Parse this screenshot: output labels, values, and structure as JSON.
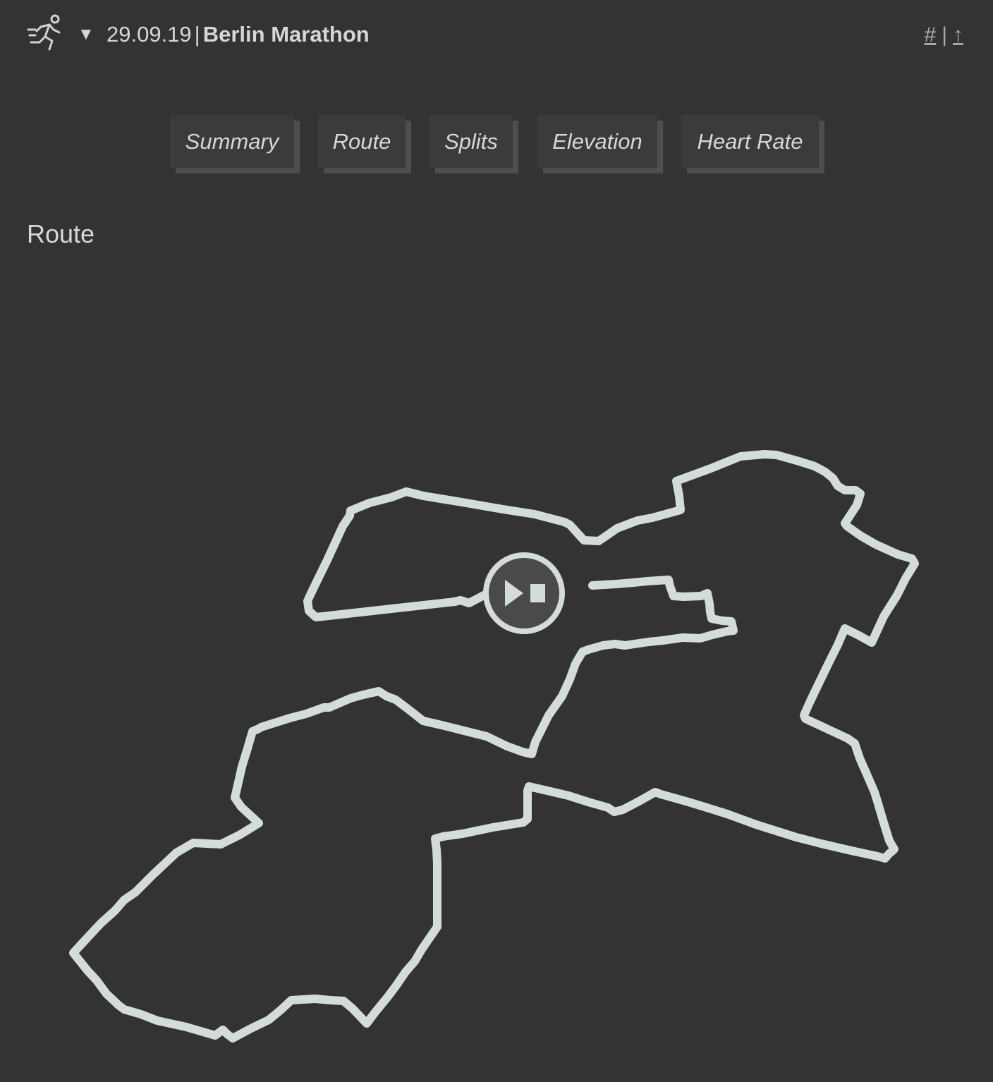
{
  "header": {
    "icon": "runner-icon",
    "toggle_icon": "triangle-down-icon",
    "toggle_glyph": "▼",
    "date": "29.09.19",
    "separator": "|",
    "event": "Berlin Marathon",
    "links": {
      "hash": "#",
      "divider": "|",
      "up": "↑"
    }
  },
  "tabs": [
    {
      "label": "Summary"
    },
    {
      "label": "Route"
    },
    {
      "label": "Splits"
    },
    {
      "label": "Elevation"
    },
    {
      "label": "Heart Rate"
    }
  ],
  "section": {
    "title": "Route"
  },
  "map": {
    "route_color": "#d4dcdb",
    "background": "#333333",
    "control_icon": "play-stop-icon"
  }
}
